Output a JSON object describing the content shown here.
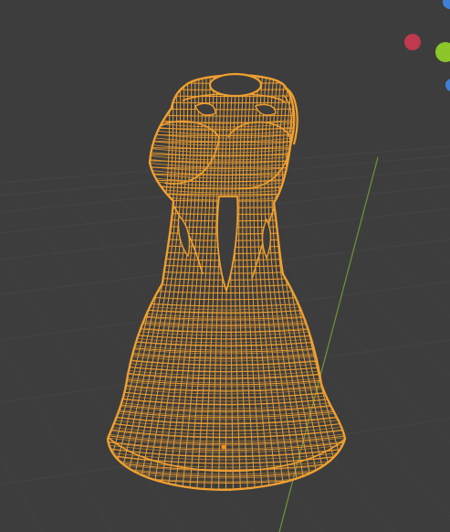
{
  "viewport": {
    "background": "#3d3d3d",
    "grid_color": "#4a4a4a",
    "y_axis_color": "#6b8f3a"
  },
  "object": {
    "display_mode": "wireframe",
    "wire_color": "#f0a030",
    "origin_color": "#ff8c1a"
  },
  "gizmo": {
    "x_axis_color": "#c0394f",
    "y_axis_color": "#8cc72a",
    "z_axis_color": "#3f7fd6"
  }
}
